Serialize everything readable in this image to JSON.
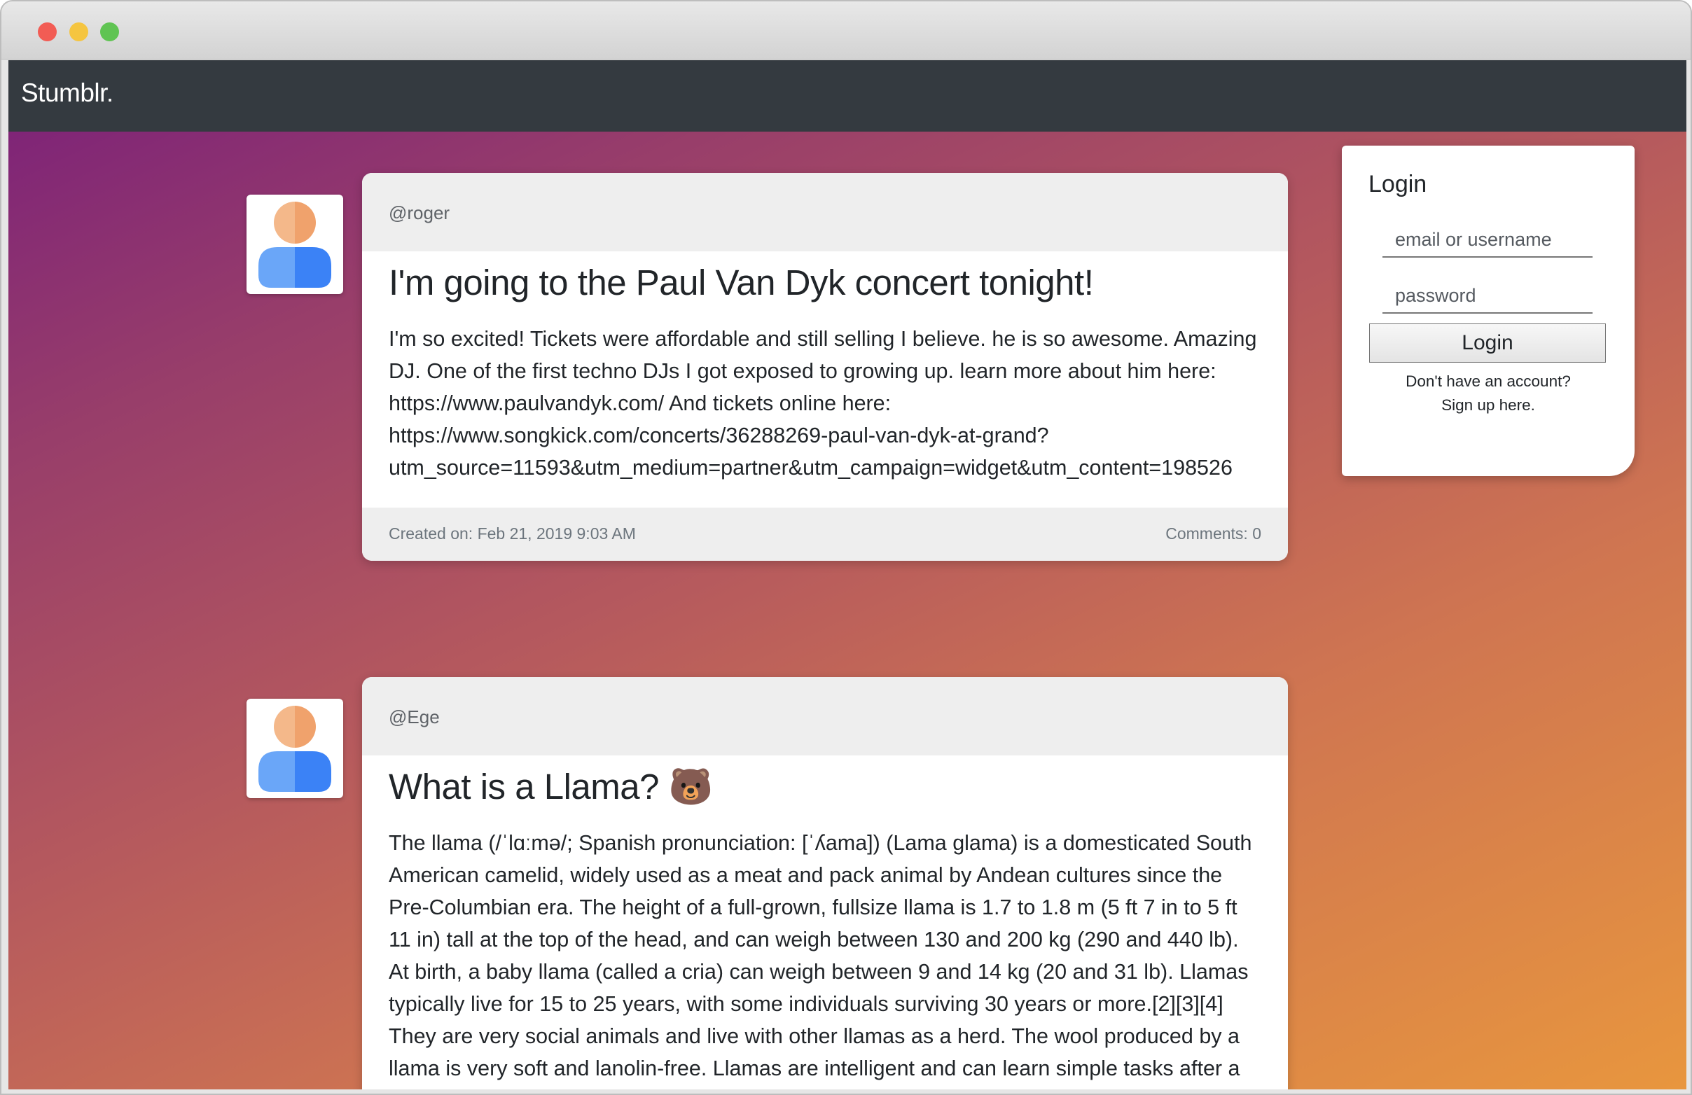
{
  "brand": "Stumblr.",
  "login": {
    "title": "Login",
    "username_placeholder": "email or username",
    "password_placeholder": "password",
    "button_label": "Login",
    "no_account_text": "Don't have an account?",
    "signup_link": "Sign up here."
  },
  "posts": [
    {
      "author": "@roger",
      "title": "I'm going to the Paul Van Dyk concert tonight!",
      "body": "I'm so excited! Tickets were affordable and still selling I believe. he is so awesome. Amazing DJ. One of the first techno DJs I got exposed to growing up. learn more about him here: https://www.paulvandyk.com/ And tickets online here: https://www.songkick.com/concerts/36288269-paul-van-dyk-at-grand?utm_source=11593&utm_medium=partner&utm_campaign=widget&utm_content=198526",
      "created": "Created on: Feb 21, 2019 9:03 AM",
      "comments": "Comments: 0"
    },
    {
      "author": "@Ege",
      "title": "What is a Llama? 🐻",
      "body": "The llama (/ˈlɑːmə/; Spanish pronunciation: [ˈʎama]) (Lama glama) is a domesticated South American camelid, widely used as a meat and pack animal by Andean cultures since the Pre-Columbian era. The height of a full-grown, fullsize llama is 1.7 to 1.8 m (5 ft 7 in to 5 ft 11 in) tall at the top of the head, and can weigh between 130 and 200 kg (290 and 440 lb). At birth, a baby llama (called a cria) can weigh between 9 and 14 kg (20 and 31 lb). Llamas typically live for 15 to 25 years, with some individuals surviving 30 years or more.[2][3][4] They are very social animals and live with other llamas as a herd. The wool produced by a llama is very soft and lanolin-free. Llamas are intelligent and can learn simple tasks after a"
    }
  ],
  "icons": {
    "avatar": "user-avatar-icon",
    "window_controls": [
      "close-icon",
      "minimize-icon",
      "zoom-icon"
    ]
  },
  "colors": {
    "navbar": "#343a40",
    "gradient_start": "#7a1f7a",
    "gradient_end": "#e8963e",
    "card_header": "#eeeeee"
  }
}
